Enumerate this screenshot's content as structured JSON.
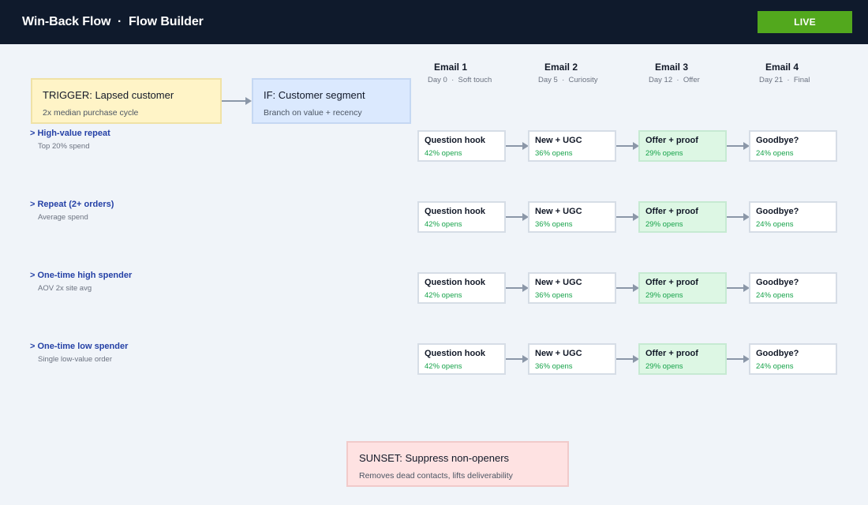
{
  "header": {
    "title": "Win-Back Flow  ·  Flow Builder",
    "status_button": "LIVE",
    "background": "#0f1a2c",
    "status_color": "#52a81d"
  },
  "columns": [
    {
      "title": "Email 1",
      "subtitle": "Day 0  ·  Soft touch"
    },
    {
      "title": "Email 2",
      "subtitle": "Day 5  ·  Curiosity"
    },
    {
      "title": "Email 3",
      "subtitle": "Day 12  ·  Offer"
    },
    {
      "title": "Email 4",
      "subtitle": "Day 21  ·  Final"
    }
  ],
  "trigger": {
    "title": "TRIGGER: Lapsed customer",
    "subtitle": "2x median purchase cycle",
    "color": "#fff4c7"
  },
  "condition": {
    "title": "IF: Customer segment",
    "subtitle": "Branch on value + recency",
    "color": "#dbe9fe"
  },
  "segments": [
    {
      "label": "> High-value repeat",
      "description": "Top 20% spend",
      "emails": [
        {
          "title": "Question hook",
          "stat": "42% opens"
        },
        {
          "title": "New + UGC",
          "stat": "36% opens"
        },
        {
          "title": "Offer + proof",
          "stat": "29% opens"
        },
        {
          "title": "Goodbye?",
          "stat": "24% opens"
        }
      ]
    },
    {
      "label": "> Repeat (2+ orders)",
      "description": "Average spend",
      "emails": [
        {
          "title": "Question hook",
          "stat": "42% opens"
        },
        {
          "title": "New + UGC",
          "stat": "36% opens"
        },
        {
          "title": "Offer + proof",
          "stat": "29% opens"
        },
        {
          "title": "Goodbye?",
          "stat": "24% opens"
        }
      ]
    },
    {
      "label": "> One-time high spender",
      "description": "AOV 2x site avg",
      "emails": [
        {
          "title": "Question hook",
          "stat": "42% opens"
        },
        {
          "title": "New + UGC",
          "stat": "36% opens"
        },
        {
          "title": "Offer + proof",
          "stat": "29% opens"
        },
        {
          "title": "Goodbye?",
          "stat": "24% opens"
        }
      ]
    },
    {
      "label": "> One-time low spender",
      "description": "Single low-value order",
      "emails": [
        {
          "title": "Question hook",
          "stat": "42% opens"
        },
        {
          "title": "New + UGC",
          "stat": "36% opens"
        },
        {
          "title": "Offer + proof",
          "stat": "29% opens"
        },
        {
          "title": "Goodbye?",
          "stat": "24% opens"
        }
      ]
    }
  ],
  "sunset": {
    "title": "SUNSET: Suppress non-openers",
    "subtitle": "Removes dead contacts, lifts deliverability",
    "color": "#fee2e2"
  },
  "colors": {
    "offer_card": "#ddf7e4",
    "open_rate_text": "#16a34a",
    "segment_link": "#2541a6",
    "connector": "#8b97a8"
  }
}
